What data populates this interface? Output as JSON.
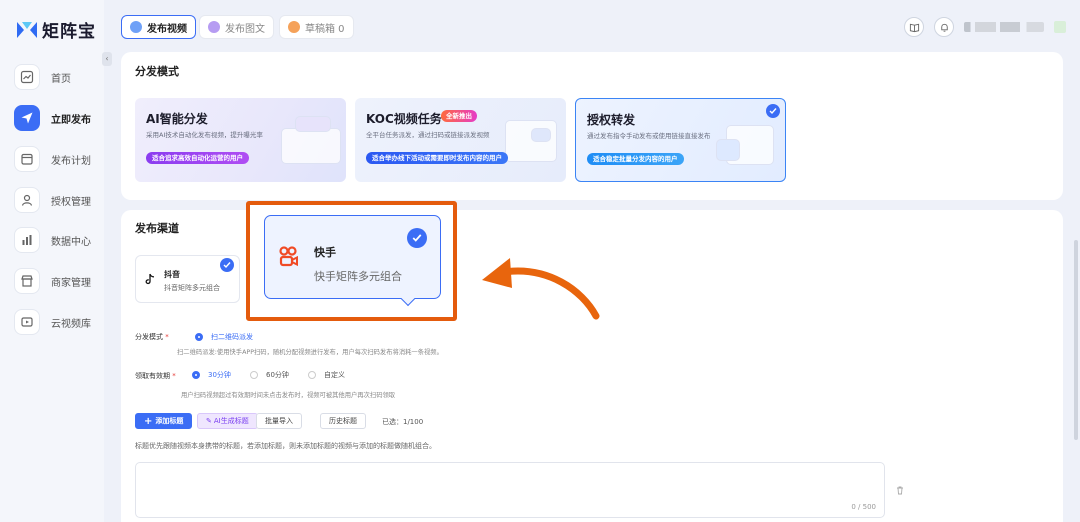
{
  "app": {
    "name": "矩阵宝"
  },
  "sidebar": {
    "items": [
      {
        "label": "首页",
        "icon": "chart-line-icon",
        "active": false
      },
      {
        "label": "立即发布",
        "icon": "send-icon",
        "active": true
      },
      {
        "label": "发布计划",
        "icon": "calendar-icon",
        "active": false
      },
      {
        "label": "授权管理",
        "icon": "user-icon",
        "active": false
      },
      {
        "label": "数据中心",
        "icon": "bar-chart-icon",
        "active": false
      },
      {
        "label": "商家管理",
        "icon": "store-icon",
        "active": false
      },
      {
        "label": "云视频库",
        "icon": "video-library-icon",
        "active": false
      }
    ],
    "collapse_glyph": "‹"
  },
  "topbar": {
    "tabs": [
      {
        "label": "发布视频",
        "active": true
      },
      {
        "label": "发布图文",
        "active": false
      },
      {
        "label": "草稿箱 0",
        "active": false
      }
    ]
  },
  "distribution": {
    "title": "分发模式",
    "cards": [
      {
        "title": "AI智能分发",
        "desc": "采用AI技术自动化发布视频，提升曝光率",
        "button": "适合追求高效自动化运营的用户",
        "selected": false
      },
      {
        "title": "KOC视频任务",
        "badge": "全新推出",
        "desc": "全平台任务派发，通过扫码或链接派发视频",
        "button": "适合举办线下活动或需要即时发布内容的用户",
        "selected": false
      },
      {
        "title": "授权转发",
        "desc": "通过发布指令手动发布或使用链接直接发布",
        "button": "适合稳定批量分发内容的用户",
        "selected": true
      }
    ]
  },
  "channels": {
    "title": "发布渠道",
    "items": [
      {
        "name": "抖音",
        "sub": "抖音矩阵多元组合",
        "selected": true
      },
      {
        "name": "快手",
        "sub": "快手矩阵多元组合",
        "selected": true
      }
    ]
  },
  "form": {
    "mode_label": "分发模式",
    "mode_option": "扫二维码派发",
    "mode_hint": "扫二维码派发:使用快手APP扫码，随机分配视频进行发布，用户每次扫码发布将消耗一条视频。",
    "validity_label": "领取有效期",
    "validity_options": [
      "30分钟",
      "60分钟",
      "自定义"
    ],
    "validity_selected": "30分钟",
    "validity_hint": "用户扫码视频超过有效期时间未点击发布时，视频可被其他用户再次扫码领取",
    "buttons": {
      "add_title": "添加标题",
      "ai_title": "AI生成标题",
      "batch_import": "批量导入",
      "history": "历史标题"
    },
    "selected_count": "已选：1/100",
    "title_hint": "标题优先跟随视频本身携带的标题，若添加标题，则未添加标题的视频与添加的标题做随机组合。",
    "char_counter": "0 / 500"
  },
  "colors": {
    "accent": "#3b6df5",
    "highlight": "#e45b0d"
  }
}
